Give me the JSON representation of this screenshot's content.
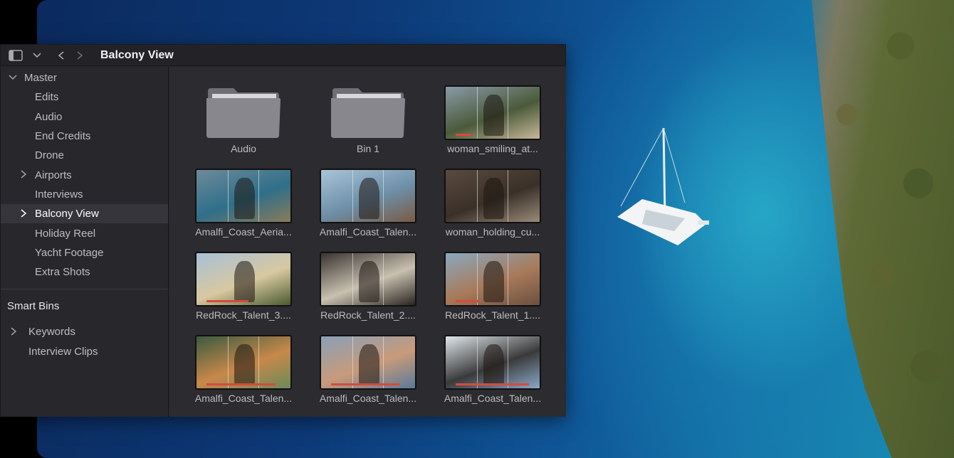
{
  "window": {
    "title": "Balcony View",
    "toolbar": {
      "sidebar_toggle_icon": "sidebar-icon",
      "dropdown_icon": "chevron-down-icon",
      "back_icon": "chevron-left-icon",
      "forward_icon": "chevron-right-icon"
    }
  },
  "sidebar": {
    "master": {
      "label": "Master",
      "expanded": true
    },
    "bins": [
      {
        "label": "Edits",
        "has_children": false,
        "selected": false
      },
      {
        "label": "Audio",
        "has_children": false,
        "selected": false
      },
      {
        "label": "End Credits",
        "has_children": false,
        "selected": false
      },
      {
        "label": "Drone",
        "has_children": false,
        "selected": false
      },
      {
        "label": "Airports",
        "has_children": true,
        "selected": false
      },
      {
        "label": "Interviews",
        "has_children": false,
        "selected": false
      },
      {
        "label": "Balcony View",
        "has_children": true,
        "selected": true
      },
      {
        "label": "Holiday Reel",
        "has_children": false,
        "selected": false
      },
      {
        "label": "Yacht Footage",
        "has_children": false,
        "selected": false
      },
      {
        "label": "Extra Shots",
        "has_children": false,
        "selected": false
      }
    ],
    "smart_bins_title": "Smart Bins",
    "smart_bins": [
      {
        "label": "Keywords",
        "has_children": true
      },
      {
        "label": "Interview Clips",
        "has_children": false
      }
    ]
  },
  "grid": {
    "items": [
      {
        "kind": "folder",
        "label": "Audio"
      },
      {
        "kind": "folder",
        "label": "Bin 1"
      },
      {
        "kind": "clip",
        "label": "woman_smiling_at...",
        "colors": [
          "#8a9aa8",
          "#4a5a3a",
          "#c9b79a"
        ],
        "progress": 0.2
      },
      {
        "kind": "clip",
        "label": "Amalfi_Coast_Aeria...",
        "colors": [
          "#6d8a9a",
          "#2f6f8a",
          "#8a7a5a"
        ],
        "progress": 0
      },
      {
        "kind": "clip",
        "label": "Amalfi_Coast_Talen...",
        "colors": [
          "#a9c4d8",
          "#6d8fa8",
          "#7a5a45"
        ],
        "progress": 0
      },
      {
        "kind": "clip",
        "label": "woman_holding_cu...",
        "colors": [
          "#5a4a40",
          "#3a3028",
          "#9a8a7a"
        ],
        "progress": 0
      },
      {
        "kind": "clip",
        "label": "RedRock_Talent_3....",
        "colors": [
          "#a8c0d8",
          "#d8c8a0",
          "#4a5a30"
        ],
        "progress": 0.55
      },
      {
        "kind": "clip",
        "label": "RedRock_Talent_2....",
        "colors": [
          "#3a3430",
          "#c8c0b0",
          "#2a2420"
        ],
        "progress": 0
      },
      {
        "kind": "clip",
        "label": "RedRock_Talent_1....",
        "colors": [
          "#8aa8c0",
          "#a87a5a",
          "#6a5040"
        ],
        "progress": 0.3
      },
      {
        "kind": "clip",
        "label": "Amalfi_Coast_Talen...",
        "colors": [
          "#3a5a40",
          "#c8884a",
          "#6a8a5a"
        ],
        "progress": 0.9
      },
      {
        "kind": "clip",
        "label": "Amalfi_Coast_Talen...",
        "colors": [
          "#8aa0b8",
          "#c89a7a",
          "#5a7a9a"
        ],
        "progress": 0.9
      },
      {
        "kind": "clip",
        "label": "Amalfi_Coast_Talen...",
        "colors": [
          "#dfe6ea",
          "#3a3a3a",
          "#8aa8c8"
        ],
        "progress": 0.95
      }
    ]
  },
  "colors": {
    "selection_bg": "#35353b",
    "playhead_bar": "#d9493b"
  }
}
